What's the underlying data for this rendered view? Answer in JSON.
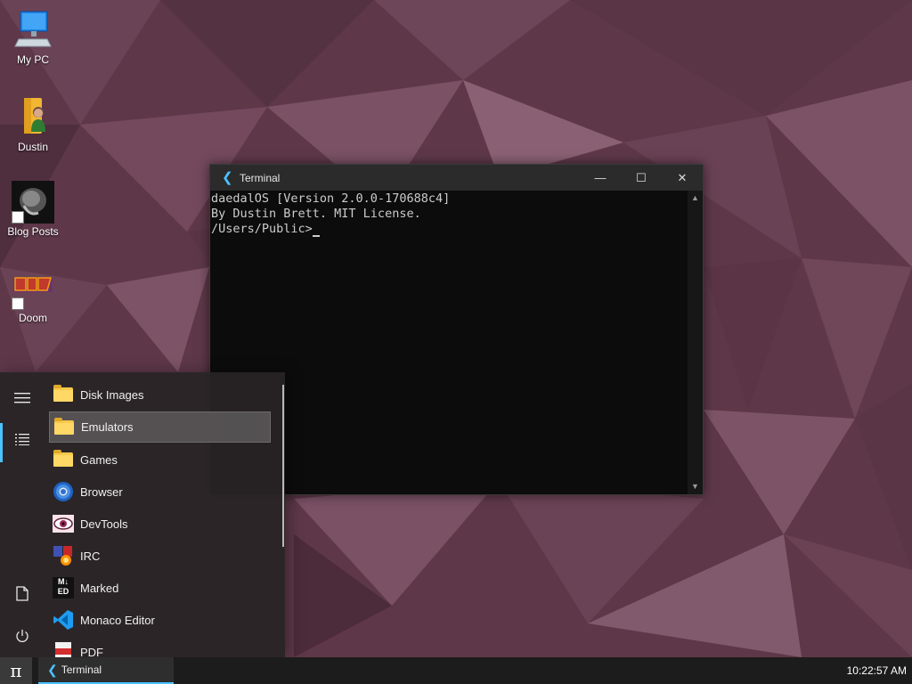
{
  "desktop": {
    "icons": [
      {
        "label": "My PC",
        "icon": "computer-icon"
      },
      {
        "label": "Dustin",
        "icon": "user-folder-icon"
      },
      {
        "label": "Blog Posts",
        "icon": "blog-posts-icon"
      },
      {
        "label": "Doom",
        "icon": "doom-icon"
      }
    ]
  },
  "terminal": {
    "title": "Terminal",
    "lines": [
      "daedalOS [Version 2.0.0-170688c4]",
      "By Dustin Brett. MIT License.",
      "",
      "/Users/Public>"
    ],
    "buttons": {
      "minimize": "—",
      "maximize": "☐",
      "close": "✕"
    }
  },
  "start_menu": {
    "sidebar": [
      "menu-icon",
      "all-apps-icon",
      "documents-icon",
      "power-icon"
    ],
    "programs": [
      {
        "label": "Disk Images",
        "icon": "folder-icon"
      },
      {
        "label": "Emulators",
        "icon": "folder-icon",
        "selected": true
      },
      {
        "label": "Games",
        "icon": "folder-icon"
      },
      {
        "label": "Browser",
        "icon": "browser-icon"
      },
      {
        "label": "DevTools",
        "icon": "devtools-icon"
      },
      {
        "label": "IRC",
        "icon": "irc-icon"
      },
      {
        "label": "Marked",
        "icon": "marked-icon"
      },
      {
        "label": "Monaco Editor",
        "icon": "monaco-editor-icon"
      },
      {
        "label": "PDF",
        "icon": "pdf-icon"
      }
    ],
    "marked_icon_text": {
      "top": "M↓",
      "bottom": "ED"
    }
  },
  "taskbar": {
    "start_symbol": "π",
    "tasks": [
      {
        "label": "Terminal",
        "icon": "terminal-icon"
      }
    ],
    "clock": "10:22:57 AM"
  },
  "colors": {
    "accent": "#4cc2ff",
    "wallpaper": "#5e3849",
    "terminal_bg": "#0c0c0c",
    "terminal_text": "#cccccc"
  }
}
